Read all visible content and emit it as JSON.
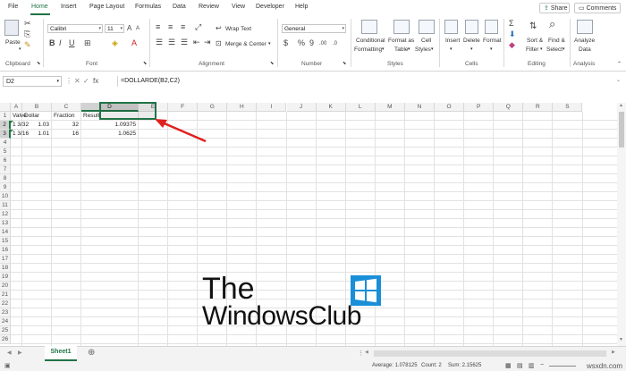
{
  "menu": {
    "items": [
      "File",
      "Home",
      "Insert",
      "Page Layout",
      "Formulas",
      "Data",
      "Review",
      "View",
      "Developer",
      "Help"
    ],
    "share": "Share",
    "comments": "Comments"
  },
  "ribbon": {
    "clipboard": {
      "paste": "Paste",
      "label": "Clipboard"
    },
    "font": {
      "name": "Calibri",
      "size": "11",
      "label": "Font"
    },
    "alignment": {
      "wrap": "Wrap Text",
      "merge": "Merge & Center",
      "label": "Alignment"
    },
    "number": {
      "format": "General",
      "label": "Number"
    },
    "styles": {
      "conditional": "Conditional",
      "conditional2": "Formatting",
      "format_as": "Format as",
      "format_as2": "Table",
      "cell": "Cell",
      "cell2": "Styles",
      "label": "Styles"
    },
    "cells": {
      "insert": "Insert",
      "delete": "Delete",
      "format": "Format",
      "label": "Cells"
    },
    "editing": {
      "sort": "Sort &",
      "sort2": "Filter",
      "find": "Find &",
      "find2": "Select",
      "label": "Editing"
    },
    "analysis": {
      "analyze": "Analyze",
      "analyze2": "Data",
      "label": "Analysis"
    }
  },
  "formula_bar": {
    "name_box": "D2",
    "fx": "fx",
    "formula": "=DOLLARDE(B2,C2)"
  },
  "grid": {
    "columns": [
      "A",
      "B",
      "C",
      "D",
      "E",
      "F",
      "G",
      "H",
      "I",
      "J",
      "K",
      "L",
      "M",
      "N",
      "O",
      "P",
      "Q",
      "R",
      "S"
    ],
    "rows": [
      "1",
      "2",
      "3",
      "4",
      "5",
      "6",
      "7",
      "8",
      "9",
      "10",
      "11",
      "12",
      "13",
      "14",
      "15",
      "16",
      "17",
      "18",
      "19",
      "20",
      "21",
      "22",
      "23",
      "24",
      "25",
      "26"
    ],
    "selected_column": "D",
    "selected_rows": [
      "2",
      "3"
    ],
    "header_row": {
      "A": "Valve",
      "B": "Dollar",
      "C": "Fraction",
      "D": "Result"
    },
    "data_rows": [
      {
        "A": "1  3/32",
        "B": "1.03",
        "C": "32",
        "D": "1.09375"
      },
      {
        "A": "1  3/16",
        "B": "1.01",
        "C": "16",
        "D": "1.0625"
      }
    ]
  },
  "sheet_tab": "Sheet1",
  "status": {
    "average": "Average: 1.078125",
    "count": "Count: 2",
    "sum": "Sum: 2.15625"
  },
  "watermark": {
    "line1": "The",
    "line2": "WindowsClub",
    "logo_color": "#1a8fd8"
  },
  "site": "wsxdn.com",
  "colors": {
    "accent": "#217346",
    "arrow": "#e02020"
  }
}
